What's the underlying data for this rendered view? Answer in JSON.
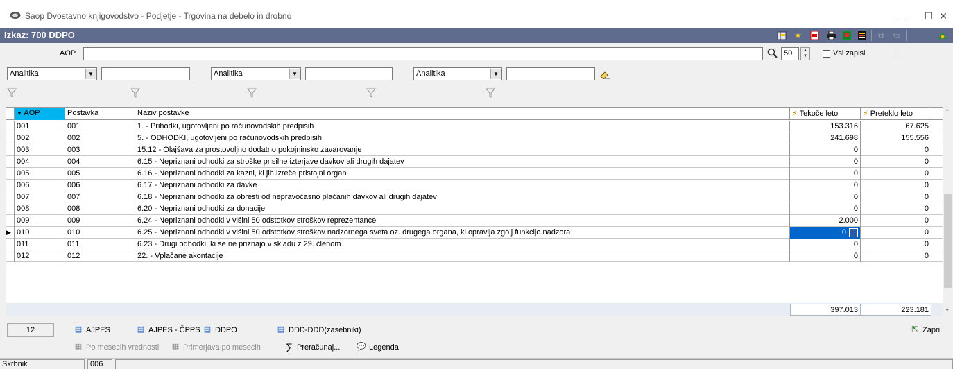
{
  "window": {
    "title": "Saop Dvostavno knjigovodstvo - Podjetje - Trgovina na debelo in drobno",
    "minimize": "—",
    "maximize": "☐",
    "close": "✕"
  },
  "report": {
    "title": "Izkaz: 700 DDPO"
  },
  "search": {
    "label": "AOP",
    "value": "",
    "count": "50",
    "all_records_label": "Vsi zapisi"
  },
  "filters": [
    {
      "combo": "Analitika",
      "text": ""
    },
    {
      "combo": "Analitika",
      "text": ""
    },
    {
      "combo": "Analitika",
      "text": ""
    }
  ],
  "columns": {
    "aop": "AOP",
    "postavka": "Postavka",
    "naziv": "Naziv postavke",
    "tekoce": "Tekoče leto",
    "preteklo": "Preteklo leto"
  },
  "rows": [
    {
      "aop": "001",
      "postavka": "001",
      "naziv": "1. - Prihodki, ugotovljeni po računovodskih predpisih",
      "tekoce": "153.316",
      "preteklo": "67.625"
    },
    {
      "aop": "002",
      "postavka": "002",
      "naziv": "5. - ODHODKI, ugotovljeni po računovodskih predpisih",
      "tekoce": "241.698",
      "preteklo": "155.556"
    },
    {
      "aop": "003",
      "postavka": "003",
      "naziv": "15.12 - Olajšava za prostovoljno dodatno pokojninsko zavarovanje",
      "tekoce": "0",
      "preteklo": "0"
    },
    {
      "aop": "004",
      "postavka": "004",
      "naziv": "6.15 - Nepriznani odhodki za stroške prisilne izterjave davkov ali drugih dajatev",
      "tekoce": "0",
      "preteklo": "0"
    },
    {
      "aop": "005",
      "postavka": "005",
      "naziv": "6.16 - Nepriznani odhodki za kazni, ki jih izreče pristojni organ",
      "tekoce": "0",
      "preteklo": "0"
    },
    {
      "aop": "006",
      "postavka": "006",
      "naziv": "6.17 - Nepriznani odhodki za davke",
      "tekoce": "0",
      "preteklo": "0"
    },
    {
      "aop": "007",
      "postavka": "007",
      "naziv": "6.18 - Nepriznani odhodki za obresti od nepravočasno plačanih davkov ali drugih dajatev",
      "tekoce": "0",
      "preteklo": "0"
    },
    {
      "aop": "008",
      "postavka": "008",
      "naziv": "6.20 - Nepriznani odhodki za donacije",
      "tekoce": "0",
      "preteklo": "0"
    },
    {
      "aop": "009",
      "postavka": "009",
      "naziv": "6.24 - Nepriznani odhodki v višini 50 odstotkov stroškov reprezentance",
      "tekoce": "2.000",
      "preteklo": "0"
    },
    {
      "aop": "010",
      "postavka": "010",
      "naziv": "6.25 - Nepriznani odhodki v višini 50 odstotkov stroškov nadzornega sveta oz. drugega organa, ki opravlja zgolj funkcijo nadzora",
      "tekoce": "0",
      "preteklo": "0"
    },
    {
      "aop": "011",
      "postavka": "011",
      "naziv": "6.23 - Drugi odhodki, ki se ne priznajo v skladu z 29. členom",
      "tekoce": "0",
      "preteklo": "0"
    },
    {
      "aop": "012",
      "postavka": "012",
      "naziv": "22. - Vplačane akontacije",
      "tekoce": "0",
      "preteklo": "0"
    }
  ],
  "totals": {
    "tekoce": "397.013",
    "preteklo": "223.181"
  },
  "bottom": {
    "record_count": "12",
    "ajpes": "AJPES",
    "ajpes_cpps": "AJPES - ČPPS",
    "ddpo": "DDPO",
    "ddd": "DDD-DDD(zasebniki)",
    "close": "Zapri",
    "po_mesecih": "Po mesecih vrednosti",
    "primerjava": "Primerjava po mesecih",
    "preracunaj": "Preračunaj...",
    "legenda": "Legenda"
  },
  "status": {
    "user": "Skrbnik",
    "code": "006"
  },
  "colors": {
    "report_bar": "#5f6c8d",
    "sort_header": "#00b4f0",
    "selected_cell": "#0066cc"
  }
}
